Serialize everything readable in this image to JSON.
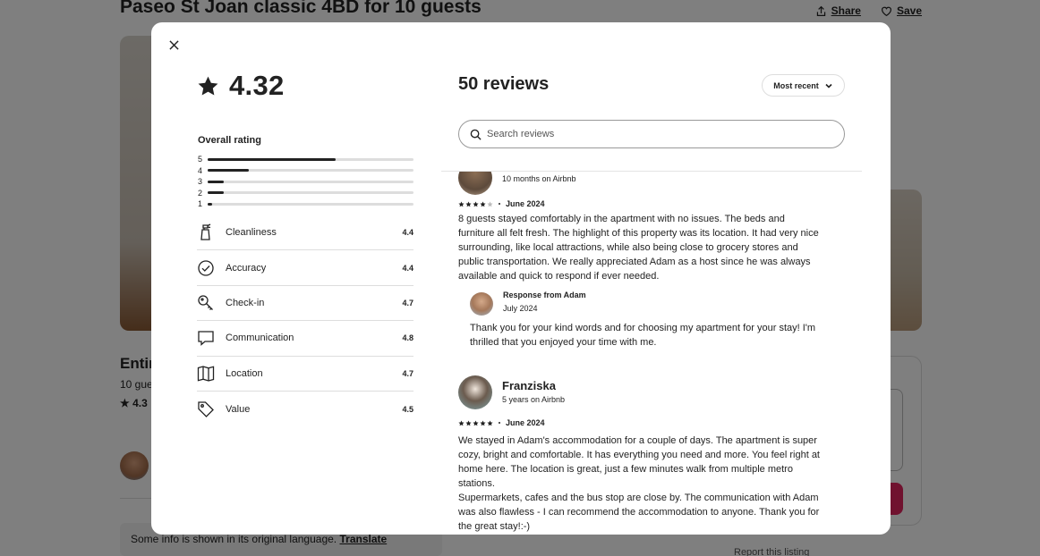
{
  "background": {
    "title": "Paseo St Joan classic 4BD for 10 guests",
    "share_label": "Share",
    "save_label": "Save",
    "entire_partial": "Entir",
    "guests_partial": "10 gue",
    "rating_partial": "★ 4.3",
    "footer_note": "Some info is shown in its original language.",
    "translate_label": "Translate",
    "report_partial": "Report this listing"
  },
  "modal": {
    "overall_score": "4.32",
    "overall_label": "Overall rating",
    "distribution": [
      {
        "stars": "5",
        "fraction": 0.62
      },
      {
        "stars": "4",
        "fraction": 0.2
      },
      {
        "stars": "3",
        "fraction": 0.08
      },
      {
        "stars": "2",
        "fraction": 0.08
      },
      {
        "stars": "1",
        "fraction": 0.02
      }
    ],
    "categories": [
      {
        "label": "Cleanliness",
        "value": "4.4",
        "icon": "spray-bottle-icon"
      },
      {
        "label": "Accuracy",
        "value": "4.4",
        "icon": "check-circle-icon"
      },
      {
        "label": "Check-in",
        "value": "4.7",
        "icon": "key-icon"
      },
      {
        "label": "Communication",
        "value": "4.8",
        "icon": "chat-bubble-icon"
      },
      {
        "label": "Location",
        "value": "4.7",
        "icon": "map-icon"
      },
      {
        "label": "Value",
        "value": "4.5",
        "icon": "price-tag-icon"
      }
    ],
    "reviews_heading": "50 reviews",
    "sort_label": "Most recent",
    "search_placeholder": "Search reviews",
    "reviews": [
      {
        "name": "",
        "member_since": "10 months on Airbnb",
        "stars": 4,
        "date": "June 2024",
        "text": "8 guests stayed comfortably in the apartment with no issues. The beds and\nfurniture all felt fresh. The highlight of this property was its location. It had very nice\nsurrounding, like local attractions, while also being close to grocery stores and\npublic transportation. We really appreciated Adam as a host since he was always\navailable and quick to respond if ever needed.",
        "response": {
          "from": "Response from Adam",
          "date": "July 2024",
          "text": "Thank you for your kind words and for choosing my apartment for your stay! I'm\nthrilled that you enjoyed your time with me."
        }
      },
      {
        "name": "Franziska",
        "member_since": "5 years on Airbnb",
        "stars": 5,
        "date": "June 2024",
        "text": "We stayed in Adam's accommodation for a couple of days. The apartment is super\ncozy, bright and comfortable. It has everything you need and more. You feel right at\nhome here. The location is great, just a few minutes walk from multiple metro\nstations.\nSupermarkets, cafes and the bus stop are close by. The communication with Adam\nwas also flawless - I can recommend the accommodation to anyone. Thank you for\nthe great stay!:-)"
      }
    ]
  }
}
